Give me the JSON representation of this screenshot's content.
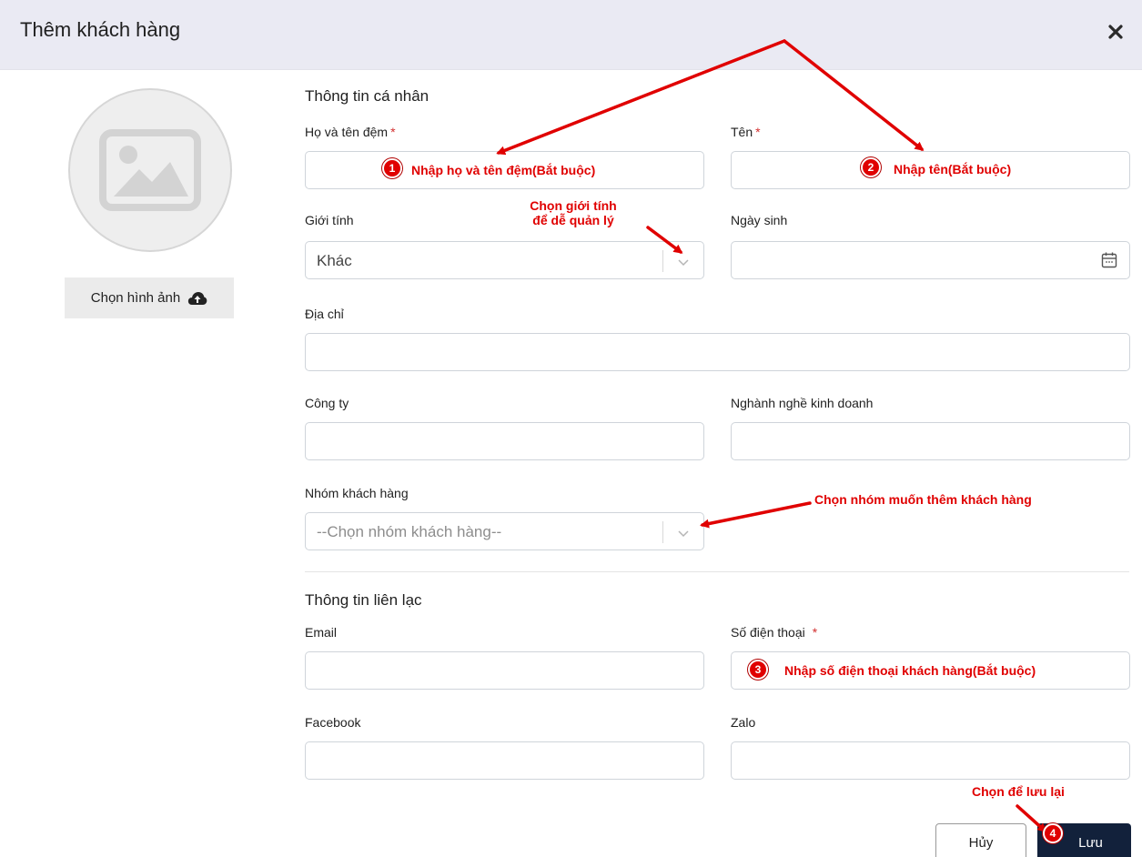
{
  "dialog": {
    "title": "Thêm khách hàng",
    "close_icon": "close-icon"
  },
  "avatar": {
    "button_label": "Chọn hình ảnh",
    "icon": "cloud-upload-icon"
  },
  "personal": {
    "section_title": "Thông tin cá nhân",
    "last_middle_name": {
      "label": "Họ và tên đệm",
      "required": "*",
      "value": ""
    },
    "first_name": {
      "label": "Tên",
      "required": "*",
      "value": ""
    },
    "gender": {
      "label": "Giới tính",
      "selected": "Khác"
    },
    "birthday": {
      "label": "Ngày sinh",
      "value": ""
    },
    "address": {
      "label": "Địa chỉ",
      "value": ""
    },
    "company": {
      "label": "Công ty",
      "value": ""
    },
    "industry": {
      "label": "Nghành nghề kinh doanh",
      "value": ""
    },
    "customer_group": {
      "label": "Nhóm khách hàng",
      "placeholder": "--Chọn nhóm khách hàng--"
    }
  },
  "contact": {
    "section_title": "Thông tin liên lạc",
    "email": {
      "label": "Email",
      "value": ""
    },
    "phone": {
      "label": "Số điện thoại",
      "required": "*",
      "value": ""
    },
    "facebook": {
      "label": "Facebook",
      "value": ""
    },
    "zalo": {
      "label": "Zalo",
      "value": ""
    }
  },
  "actions": {
    "cancel_label": "Hủy",
    "save_label": "Lưu"
  },
  "annotations": {
    "step1": {
      "number": "1",
      "text": "Nhập họ và tên đệm(Bắt buộc)"
    },
    "step2": {
      "number": "2",
      "text": "Nhập tên(Bắt buộc)"
    },
    "step3": {
      "number": "3",
      "text": "Nhập số điện thoại khách hàng(Bắt buộc)"
    },
    "step4": {
      "number": "4"
    },
    "gender_line1": "Chọn giới tính",
    "gender_line2": "để dễ quản lý",
    "group_hint": "Chọn nhóm muốn thêm khách hàng",
    "save_hint": "Chọn để lưu lại",
    "color": "#e00000"
  }
}
